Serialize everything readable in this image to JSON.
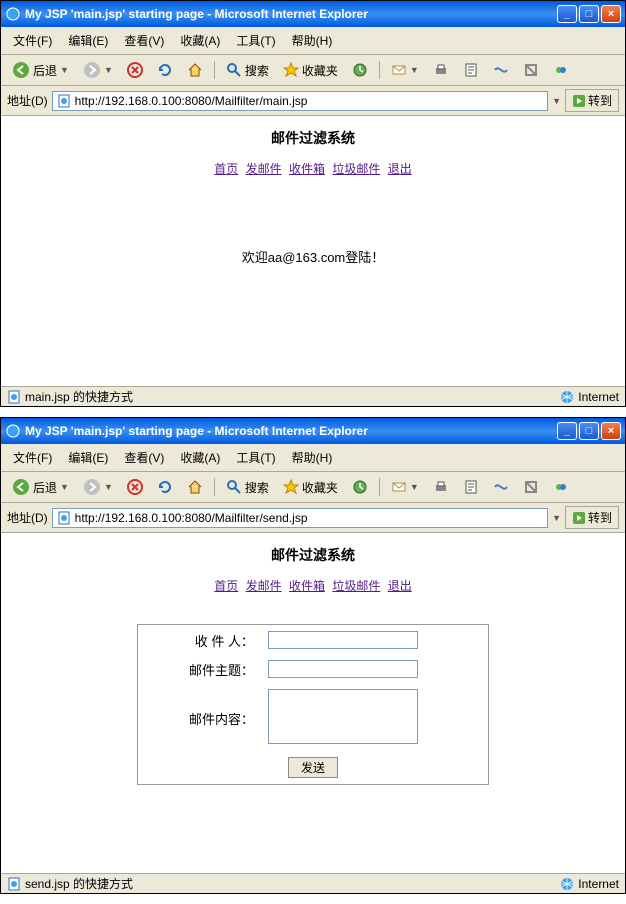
{
  "window1": {
    "title": "My JSP 'main.jsp' starting page - Microsoft Internet Explorer",
    "menus": [
      "文件(F)",
      "编辑(E)",
      "查看(V)",
      "收藏(A)",
      "工具(T)",
      "帮助(H)"
    ],
    "back_label": "后退",
    "search_label": "搜索",
    "fav_label": "收藏夹",
    "addr_label": "地址(D)",
    "url": "http://192.168.0.100:8080/Mailfilter/main.jsp",
    "go_label": "转到",
    "page_title": "邮件过滤系统",
    "nav": {
      "home": "首页",
      "send": "发邮件",
      "inbox": "收件箱",
      "spam": "垃圾邮件",
      "logout": "退出"
    },
    "welcome": "欢迎aa@163.com登陆！",
    "status": "main.jsp 的快捷方式",
    "status_right": "Internet"
  },
  "window2": {
    "title": "My JSP 'main.jsp' starting page - Microsoft Internet Explorer",
    "menus": [
      "文件(F)",
      "编辑(E)",
      "查看(V)",
      "收藏(A)",
      "工具(T)",
      "帮助(H)"
    ],
    "back_label": "后退",
    "search_label": "搜索",
    "fav_label": "收藏夹",
    "addr_label": "地址(D)",
    "url": "http://192.168.0.100:8080/Mailfilter/send.jsp",
    "go_label": "转到",
    "page_title": "邮件过滤系统",
    "nav": {
      "home": "首页",
      "send": "发邮件",
      "inbox": "收件箱",
      "spam": "垃圾邮件",
      "logout": "退出"
    },
    "form": {
      "recipient_label": "收 件 人：",
      "subject_label": "邮件主题：",
      "body_label": "邮件内容：",
      "submit": "发送"
    },
    "status": "send.jsp 的快捷方式",
    "status_right": "Internet"
  }
}
